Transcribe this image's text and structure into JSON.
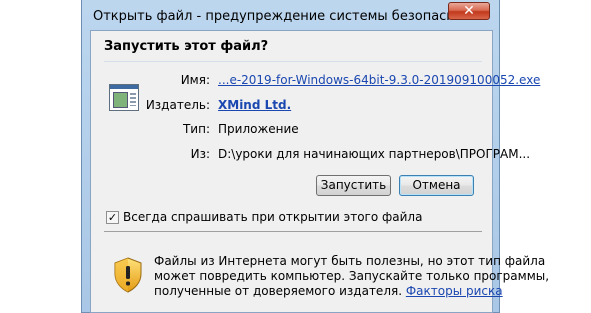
{
  "window": {
    "title": "Открыть файл - предупреждение системы безопасности",
    "close_symbol": "✕"
  },
  "dialog": {
    "heading": "Запустить этот файл?",
    "file_icon": "application-file-icon",
    "fields": {
      "name_label": "Имя:",
      "name_value": "...e-2019-for-Windows-64bit-9.3.0-201909100052.exe",
      "publisher_label": "Издатель:",
      "publisher_value": "XMind Ltd.",
      "type_label": "Тип:",
      "type_value": "Приложение",
      "from_label": "Из:",
      "from_value": "D:\\уроки для начинающих партнеров\\ПРОГРАМ..."
    },
    "buttons": {
      "run": "Запустить",
      "cancel": "Отмена"
    },
    "checkbox": {
      "checked": true,
      "mark": "✓",
      "label": "Всегда спрашивать при открытии этого файла"
    },
    "warning": {
      "icon": "shield-warning-icon",
      "line1": "Файлы из Интернета могут быть полезны, но этот тип файла",
      "line2": "может повредить компьютер. Запускайте только программы,",
      "line3_prefix": "полученные от доверяемого издателя.",
      "line3_link": "Факторы риска"
    }
  },
  "colors": {
    "frame": "#a9c7e6",
    "client_bg": "#f0f0f0",
    "link": "#1a47b0",
    "close_button": "#c2391d"
  }
}
